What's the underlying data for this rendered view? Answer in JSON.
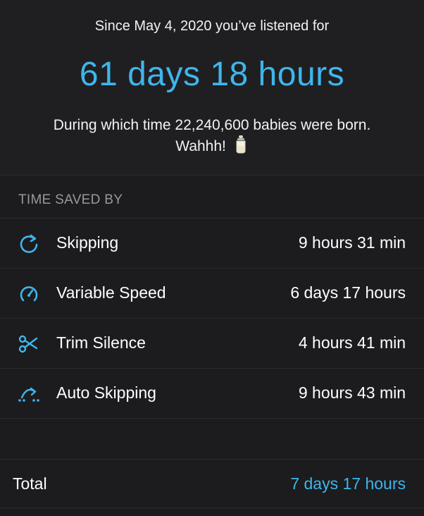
{
  "summary": {
    "since_text": "Since May 4, 2020 you’ve listened for",
    "listened_duration": "61 days 18 hours",
    "babies_text": "During which time 22,240,600 babies were born. Wahhh!",
    "babies_emoji_icon": "baby-bottle-icon"
  },
  "time_saved": {
    "header": "TIME SAVED BY",
    "rows": [
      {
        "icon": "skip-forward-icon",
        "label": "Skipping",
        "value": "9 hours 31 min"
      },
      {
        "icon": "speedometer-icon",
        "label": "Variable Speed",
        "value": "6 days 17 hours"
      },
      {
        "icon": "scissors-icon",
        "label": "Trim Silence",
        "value": "4 hours 41 min"
      },
      {
        "icon": "auto-skip-icon",
        "label": "Auto Skipping",
        "value": "9 hours 43 min"
      }
    ]
  },
  "total": {
    "label": "Total",
    "value": "7 days 17 hours"
  },
  "colors": {
    "accent": "#3fb5ec",
    "background": "#1c1c1e",
    "header_text": "#98989d"
  }
}
